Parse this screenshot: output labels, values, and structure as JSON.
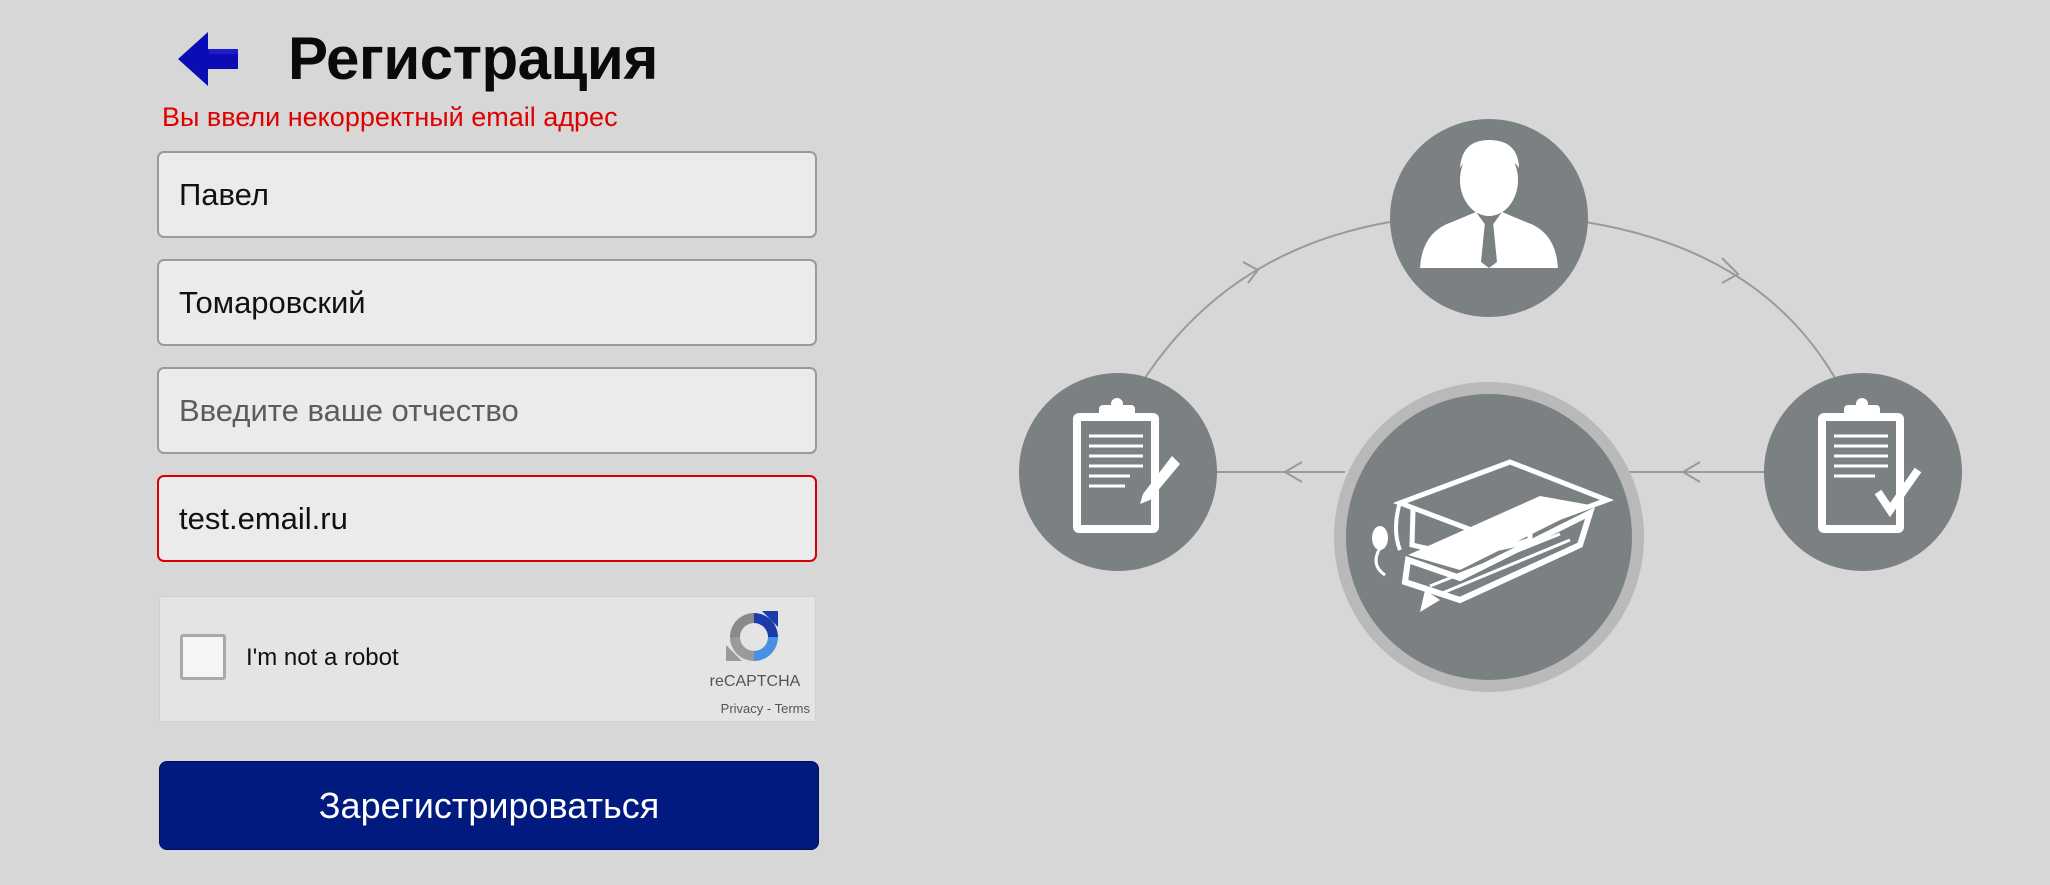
{
  "header": {
    "back_icon": "arrow-left-icon",
    "title": "Регистрация"
  },
  "form": {
    "error_message": "Вы ввели некорректный email адрес",
    "first_name": {
      "value": "Павел"
    },
    "last_name": {
      "value": "Томаровский"
    },
    "patronymic": {
      "value": "",
      "placeholder": "Введите ваше отчество"
    },
    "email": {
      "value": "test.email.ru"
    },
    "submit_label": "Зарегистрироваться"
  },
  "recaptcha": {
    "label": "I'm not a robot",
    "brand": "reCAPTCHA",
    "privacy": "Privacy",
    "separator": " - ",
    "terms": "Terms"
  },
  "illustration": {
    "icons": [
      "person-icon",
      "clipboard-edit-icon",
      "graduation-book-icon",
      "clipboard-check-icon"
    ]
  },
  "colors": {
    "background": "#d7d7d7",
    "accent": "#001a80",
    "error": "#e10000",
    "icon_circle": "#7b8183"
  }
}
